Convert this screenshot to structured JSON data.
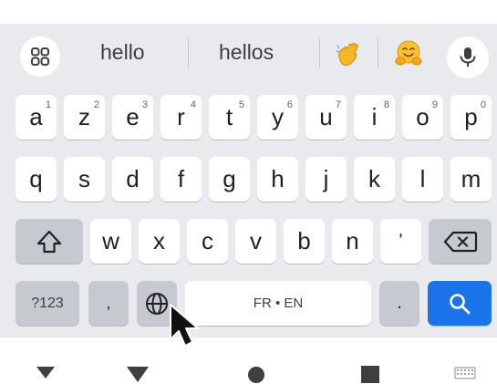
{
  "suggestions": {
    "grid_icon": "grid-icon",
    "words": [
      "hello",
      "hellos"
    ],
    "emojis": [
      "waving-hand-emoji",
      "hugging-face-emoji"
    ],
    "mic_icon": "microphone-icon"
  },
  "rows": [
    [
      {
        "label": "a",
        "hint": "1"
      },
      {
        "label": "z",
        "hint": "2"
      },
      {
        "label": "e",
        "hint": "3"
      },
      {
        "label": "r",
        "hint": "4"
      },
      {
        "label": "t",
        "hint": "5"
      },
      {
        "label": "y",
        "hint": "6"
      },
      {
        "label": "u",
        "hint": "7"
      },
      {
        "label": "i",
        "hint": "8"
      },
      {
        "label": "o",
        "hint": "9"
      },
      {
        "label": "p",
        "hint": "0"
      }
    ],
    [
      {
        "label": "q"
      },
      {
        "label": "s"
      },
      {
        "label": "d"
      },
      {
        "label": "f"
      },
      {
        "label": "g"
      },
      {
        "label": "h"
      },
      {
        "label": "j"
      },
      {
        "label": "k"
      },
      {
        "label": "l"
      },
      {
        "label": "m"
      }
    ],
    [
      {
        "label": "w"
      },
      {
        "label": "x"
      },
      {
        "label": "c"
      },
      {
        "label": "v"
      },
      {
        "label": "b"
      },
      {
        "label": "n"
      },
      {
        "label": "'"
      }
    ]
  ],
  "bottom_row": {
    "symbols": "?123",
    "comma": ",",
    "space": "FR • EN",
    "period": "."
  },
  "colors": {
    "keyboard_bg": "#e8eaed",
    "key_bg": "#ffffff",
    "function_key_bg": "#c6cad0",
    "search_key_bg": "#1a73e8"
  },
  "icons": {
    "shift": "shift-icon",
    "backspace": "backspace-icon",
    "language": "globe-icon",
    "search": "search-icon",
    "nav_back": "back-icon",
    "nav_home": "home-icon",
    "nav_recents": "recents-icon",
    "nav_keyboard": "keyboard-switch-icon"
  }
}
